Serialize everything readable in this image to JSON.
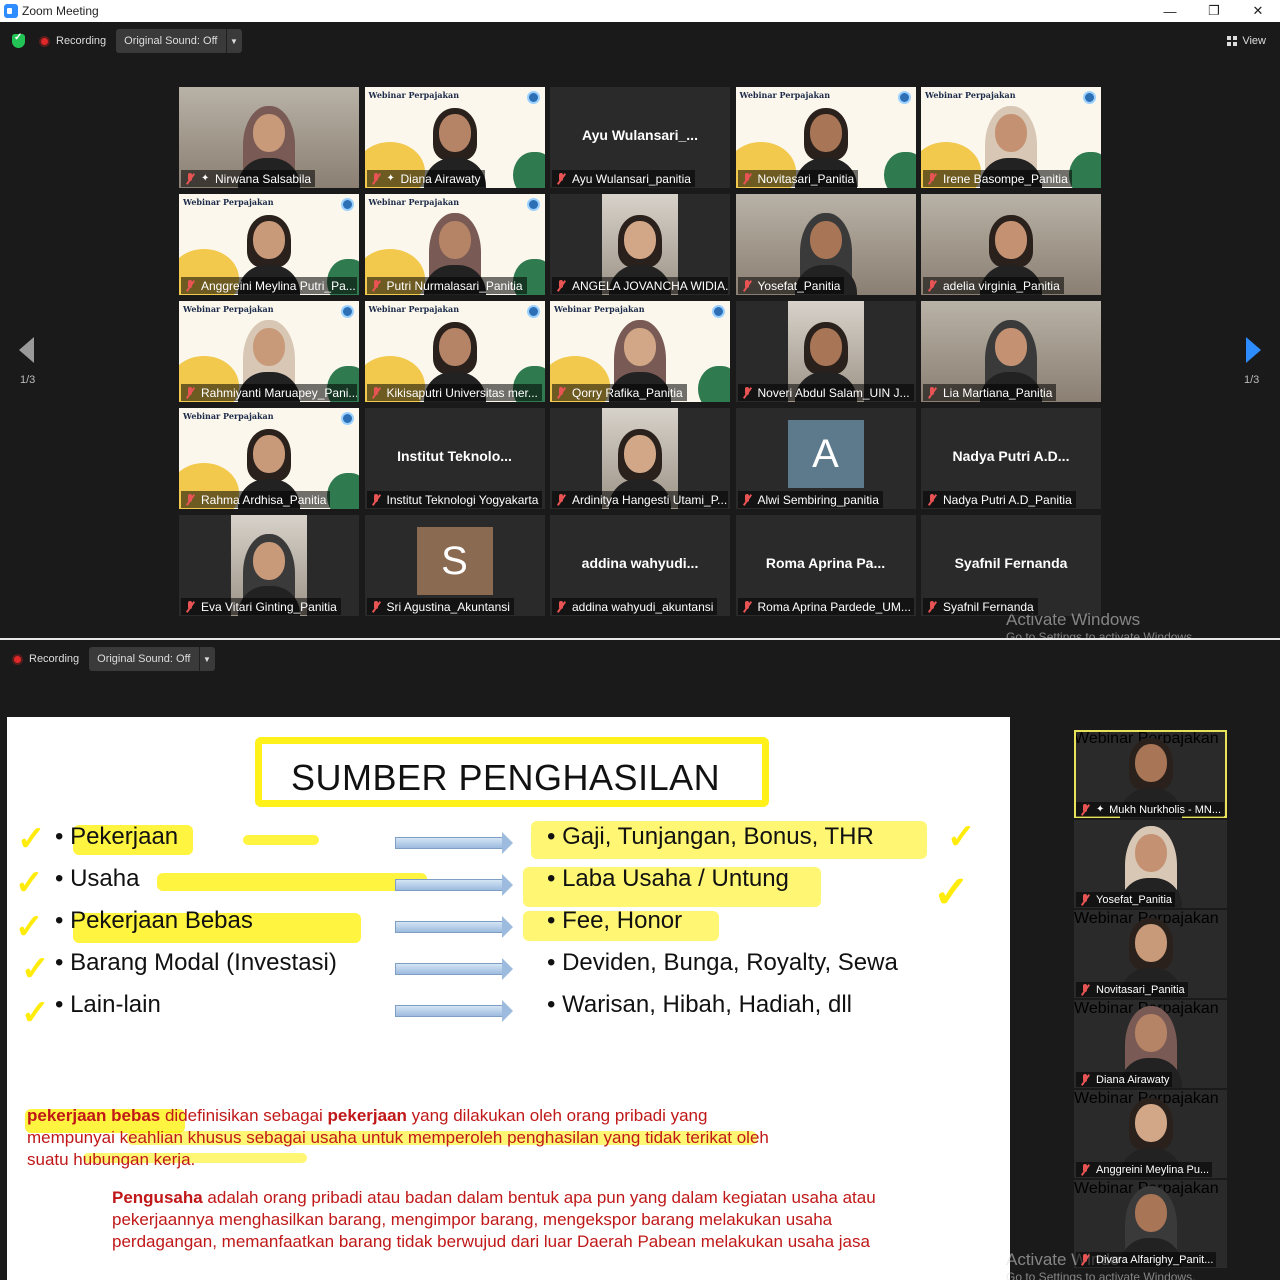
{
  "window": {
    "title": "Zoom Meeting",
    "min": "—",
    "restore": "❐",
    "close": "✕"
  },
  "toolbar_top": {
    "recording": "Recording",
    "original_sound": "Original Sound: Off",
    "view": "View"
  },
  "toolbar_bottom": {
    "recording": "Recording",
    "original_sound": "Original Sound: Off"
  },
  "pager": {
    "left": "1/3",
    "right": "1/3"
  },
  "gallery": [
    {
      "name": "Nirwana Salsabila",
      "kind": "cam",
      "pinned": true
    },
    {
      "name": "Diana Airawaty",
      "kind": "webinar",
      "pinned": true,
      "active": true
    },
    {
      "name": "Ayu Wulansari_panitia",
      "kind": "name",
      "display": "Ayu  Wulansari_..."
    },
    {
      "name": "Novitasari_Panitia",
      "kind": "webinar"
    },
    {
      "name": "Irene Basompe_Panitia",
      "kind": "webinar"
    },
    {
      "name": "Anggreini Meylina Putri_Pa...",
      "kind": "webinar"
    },
    {
      "name": "Putri Nurmalasari_Panitia",
      "kind": "webinar"
    },
    {
      "name": "ANGELA JOVANCHA WIDIA...",
      "kind": "mini"
    },
    {
      "name": "Yosefat_Panitia",
      "kind": "cam"
    },
    {
      "name": "adelia virginia_Panitia",
      "kind": "cam"
    },
    {
      "name": "Rahmiyanti Maruapey_Pani...",
      "kind": "webinar"
    },
    {
      "name": "Kikisaputri Universitas mer...",
      "kind": "webinar"
    },
    {
      "name": "Qorry Rafika_Panitia",
      "kind": "webinar"
    },
    {
      "name": "Noveri Abdul Salam_UIN J...",
      "kind": "mini"
    },
    {
      "name": "Lia Martiana_Panitia",
      "kind": "cam"
    },
    {
      "name": "Rahma Ardhisa_Panitia",
      "kind": "webinar"
    },
    {
      "name": "Institut Teknologi Yogyakarta",
      "kind": "name",
      "display": "Institut  Teknolo..."
    },
    {
      "name": "Ardinitya Hangesti Utami_P...",
      "kind": "mini"
    },
    {
      "name": "Alwi Sembiring_panitia",
      "kind": "avatar",
      "letter": "A",
      "color": "#5d7a8c"
    },
    {
      "name": "Nadya Putri A.D_Panitia",
      "kind": "name",
      "display": "Nadya  Putri  A.D..."
    },
    {
      "name": "Eva Vitari Ginting_Panitia",
      "kind": "mini"
    },
    {
      "name": "Sri Agustina_Akuntansi",
      "kind": "avatar",
      "letter": "S",
      "color": "#8b6a52"
    },
    {
      "name": "addina wahyudi_akuntansi",
      "kind": "name",
      "display": "addina  wahyudi..."
    },
    {
      "name": "Roma Aprina Pardede_UM...",
      "kind": "name",
      "display": "Roma  Aprina  Pa..."
    },
    {
      "name": "Syafnil Fernanda",
      "kind": "name",
      "display": "Syafnil  Fernanda"
    }
  ],
  "webinar_banner": "Webinar Perpajakan",
  "watermark": {
    "title": "Activate Windows",
    "sub": "Go to Settings to activate Windows."
  },
  "slide": {
    "title": "SUMBER PENGHASILAN",
    "left": [
      "Pekerjaan",
      "Usaha",
      "Pekerjaan Bebas",
      "Barang Modal (Investasi)",
      "Lain-lain"
    ],
    "right": [
      "Gaji, Tunjangan, Bonus, THR",
      "Laba Usaha / Untung",
      "Fee, Honor",
      "Deviden, Bunga, Royalty, Sewa",
      "Warisan, Hibah, Hadiah, dll"
    ],
    "def1_term": "pekerjaan bebas",
    "def1_a": " didefinisikan sebagai ",
    "def1_b": "pekerjaan",
    "def1_c": " yang dilakukan oleh orang pribadi yang mempunyai keahlian khusus sebagai usaha untuk memperoleh penghasilan yang tidak terikat oleh suatu hubungan kerja.",
    "def2_term": "Pengusaha",
    "def2_text": " adalah orang pribadi atau badan dalam bentuk apa pun yang dalam kegiatan usaha atau pekerjaannya menghasilkan barang, mengimpor barang, mengekspor barang melakukan usaha perdagangan, memanfaatkan barang tidak berwujud dari luar Daerah Pabean melakukan usaha jasa"
  },
  "side": [
    {
      "name": "Mukh Nurkholis - MN...",
      "kind": "webinar",
      "pinned": true,
      "active": true
    },
    {
      "name": "Yosefat_Panitia",
      "kind": "cam"
    },
    {
      "name": "Novitasari_Panitia",
      "kind": "webinar"
    },
    {
      "name": "Diana Airawaty",
      "kind": "webinar"
    },
    {
      "name": "Anggreini Meylina Pu...",
      "kind": "webinar"
    },
    {
      "name": "Divara Alfarighy_Panit...",
      "kind": "webinar"
    }
  ]
}
